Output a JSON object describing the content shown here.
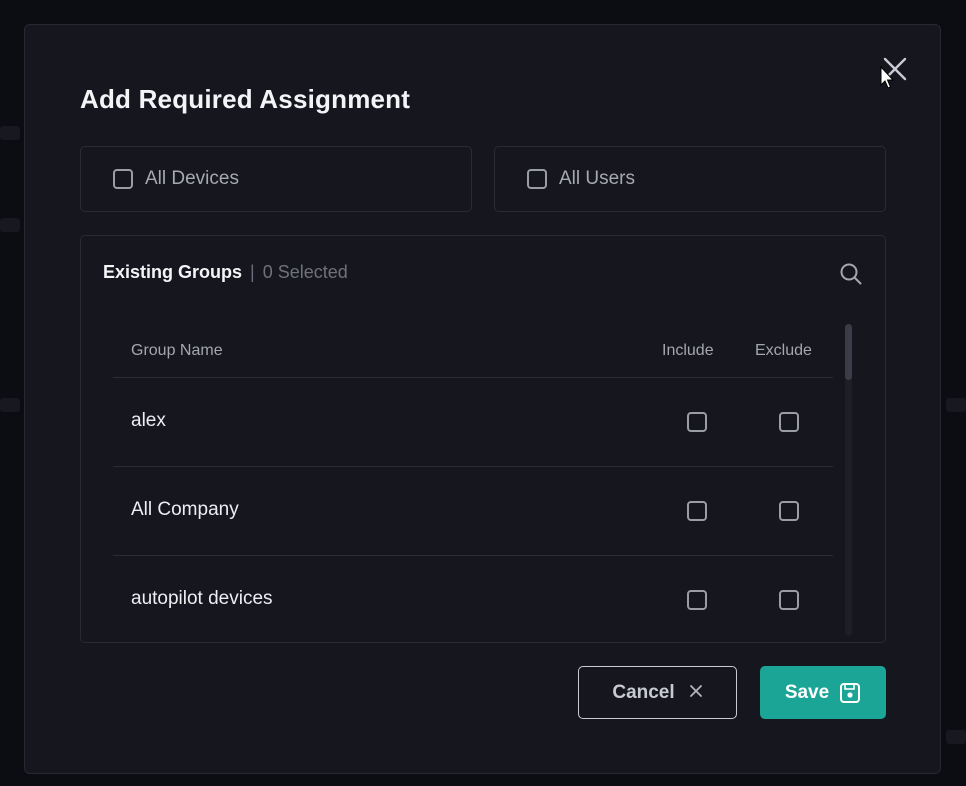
{
  "modal": {
    "title": "Add Required Assignment",
    "close_icon": "close-icon"
  },
  "targets": {
    "all_devices_label": "All Devices",
    "all_devices_checked": false,
    "all_users_label": "All Users",
    "all_users_checked": false
  },
  "groups": {
    "title": "Existing Groups",
    "separator": "|",
    "selected_text": "0 Selected",
    "search_icon": "search-icon",
    "columns": {
      "name": "Group Name",
      "include": "Include",
      "exclude": "Exclude"
    },
    "rows": [
      {
        "name": "alex",
        "include": false,
        "exclude": false
      },
      {
        "name": "All Company",
        "include": false,
        "exclude": false
      },
      {
        "name": "autopilot devices",
        "include": false,
        "exclude": false
      }
    ]
  },
  "footer": {
    "cancel_label": "Cancel",
    "cancel_icon": "close-icon",
    "save_label": "Save",
    "save_icon": "floppy-disk-icon"
  },
  "colors": {
    "accent": "#1aa596",
    "modal_bg": "#15161e",
    "border": "#282a35"
  }
}
